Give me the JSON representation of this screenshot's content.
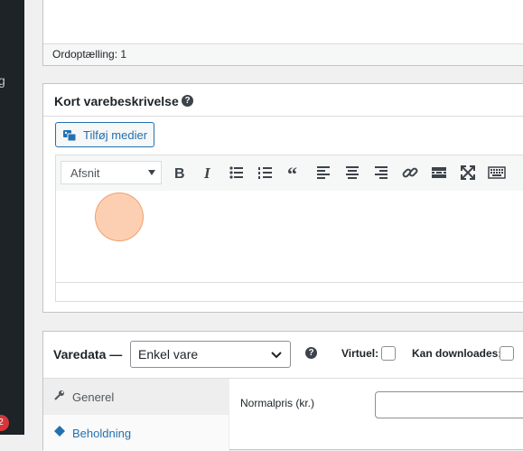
{
  "sidebar": {
    "partial_label": "g",
    "notification_count": "2"
  },
  "top_panel": {
    "word_count": "Ordoptælling: 1"
  },
  "short_description": {
    "title": "Kort varebeskrivelse",
    "help_glyph": "?",
    "add_media_label": "Tilføj medier",
    "format_select_value": "Afsnit",
    "toolbar_icons": [
      "bold-icon",
      "italic-icon",
      "bullet-list-icon",
      "numbered-list-icon",
      "blockquote-icon",
      "align-left-icon",
      "align-center-icon",
      "align-right-icon",
      "link-icon",
      "read-more-icon",
      "fullscreen-icon",
      "toolbar-toggle-icon"
    ]
  },
  "product_data": {
    "title": "Varedata —",
    "type_select_value": "Enkel vare",
    "help_glyph": "?",
    "virtual_label": "Virtuel:",
    "virtual_checked": false,
    "downloadable_label": "Kan downloades:",
    "downloadable_checked": false,
    "tabs": [
      {
        "label": "Generel",
        "icon": "wrench-icon"
      },
      {
        "label": "Beholdning",
        "icon": "inventory-icon"
      }
    ],
    "regular_price_label": "Normalpris (kr.)",
    "regular_price_value": ""
  },
  "colors": {
    "accent": "#2271b1",
    "sidebar": "#1d2327",
    "badge": "#d63638",
    "click_marker": "#fba872"
  }
}
